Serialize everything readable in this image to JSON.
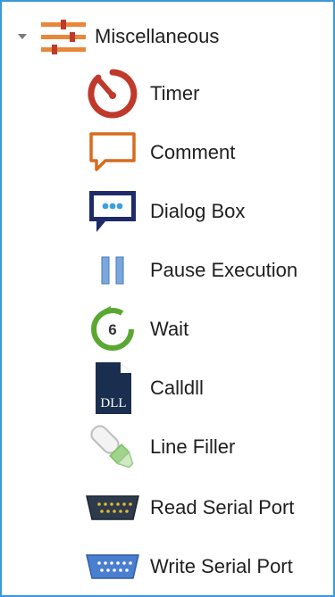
{
  "tree": {
    "group": {
      "label": "Miscellaneous",
      "icon": "sliders-icon",
      "expanded": true
    },
    "items": [
      {
        "label": "Timer",
        "icon": "timer-icon"
      },
      {
        "label": "Comment",
        "icon": "comment-icon"
      },
      {
        "label": "Dialog Box",
        "icon": "dialog-box-icon"
      },
      {
        "label": "Pause Execution",
        "icon": "pause-icon"
      },
      {
        "label": "Wait",
        "icon": "wait-icon",
        "icon_text": "6"
      },
      {
        "label": "Calldll",
        "icon": "dll-file-icon",
        "icon_text": "DLL"
      },
      {
        "label": "Line Filler",
        "icon": "line-filler-icon"
      },
      {
        "label": "Read Serial Port",
        "icon": "read-serial-port-icon"
      },
      {
        "label": "Write Serial Port",
        "icon": "write-serial-port-icon"
      }
    ]
  },
  "colors": {
    "border": "#3a9ad9",
    "timer": "#c0392b",
    "comment": "#d86b1f",
    "dialog": "#1f2a6b",
    "pause": "#7aa7dd",
    "wait": "#5aa832",
    "dll": "#1a2f4f",
    "filler": "#9fd48a",
    "serial_read": "#2d3b4c",
    "serial_write": "#4a7fd0"
  }
}
